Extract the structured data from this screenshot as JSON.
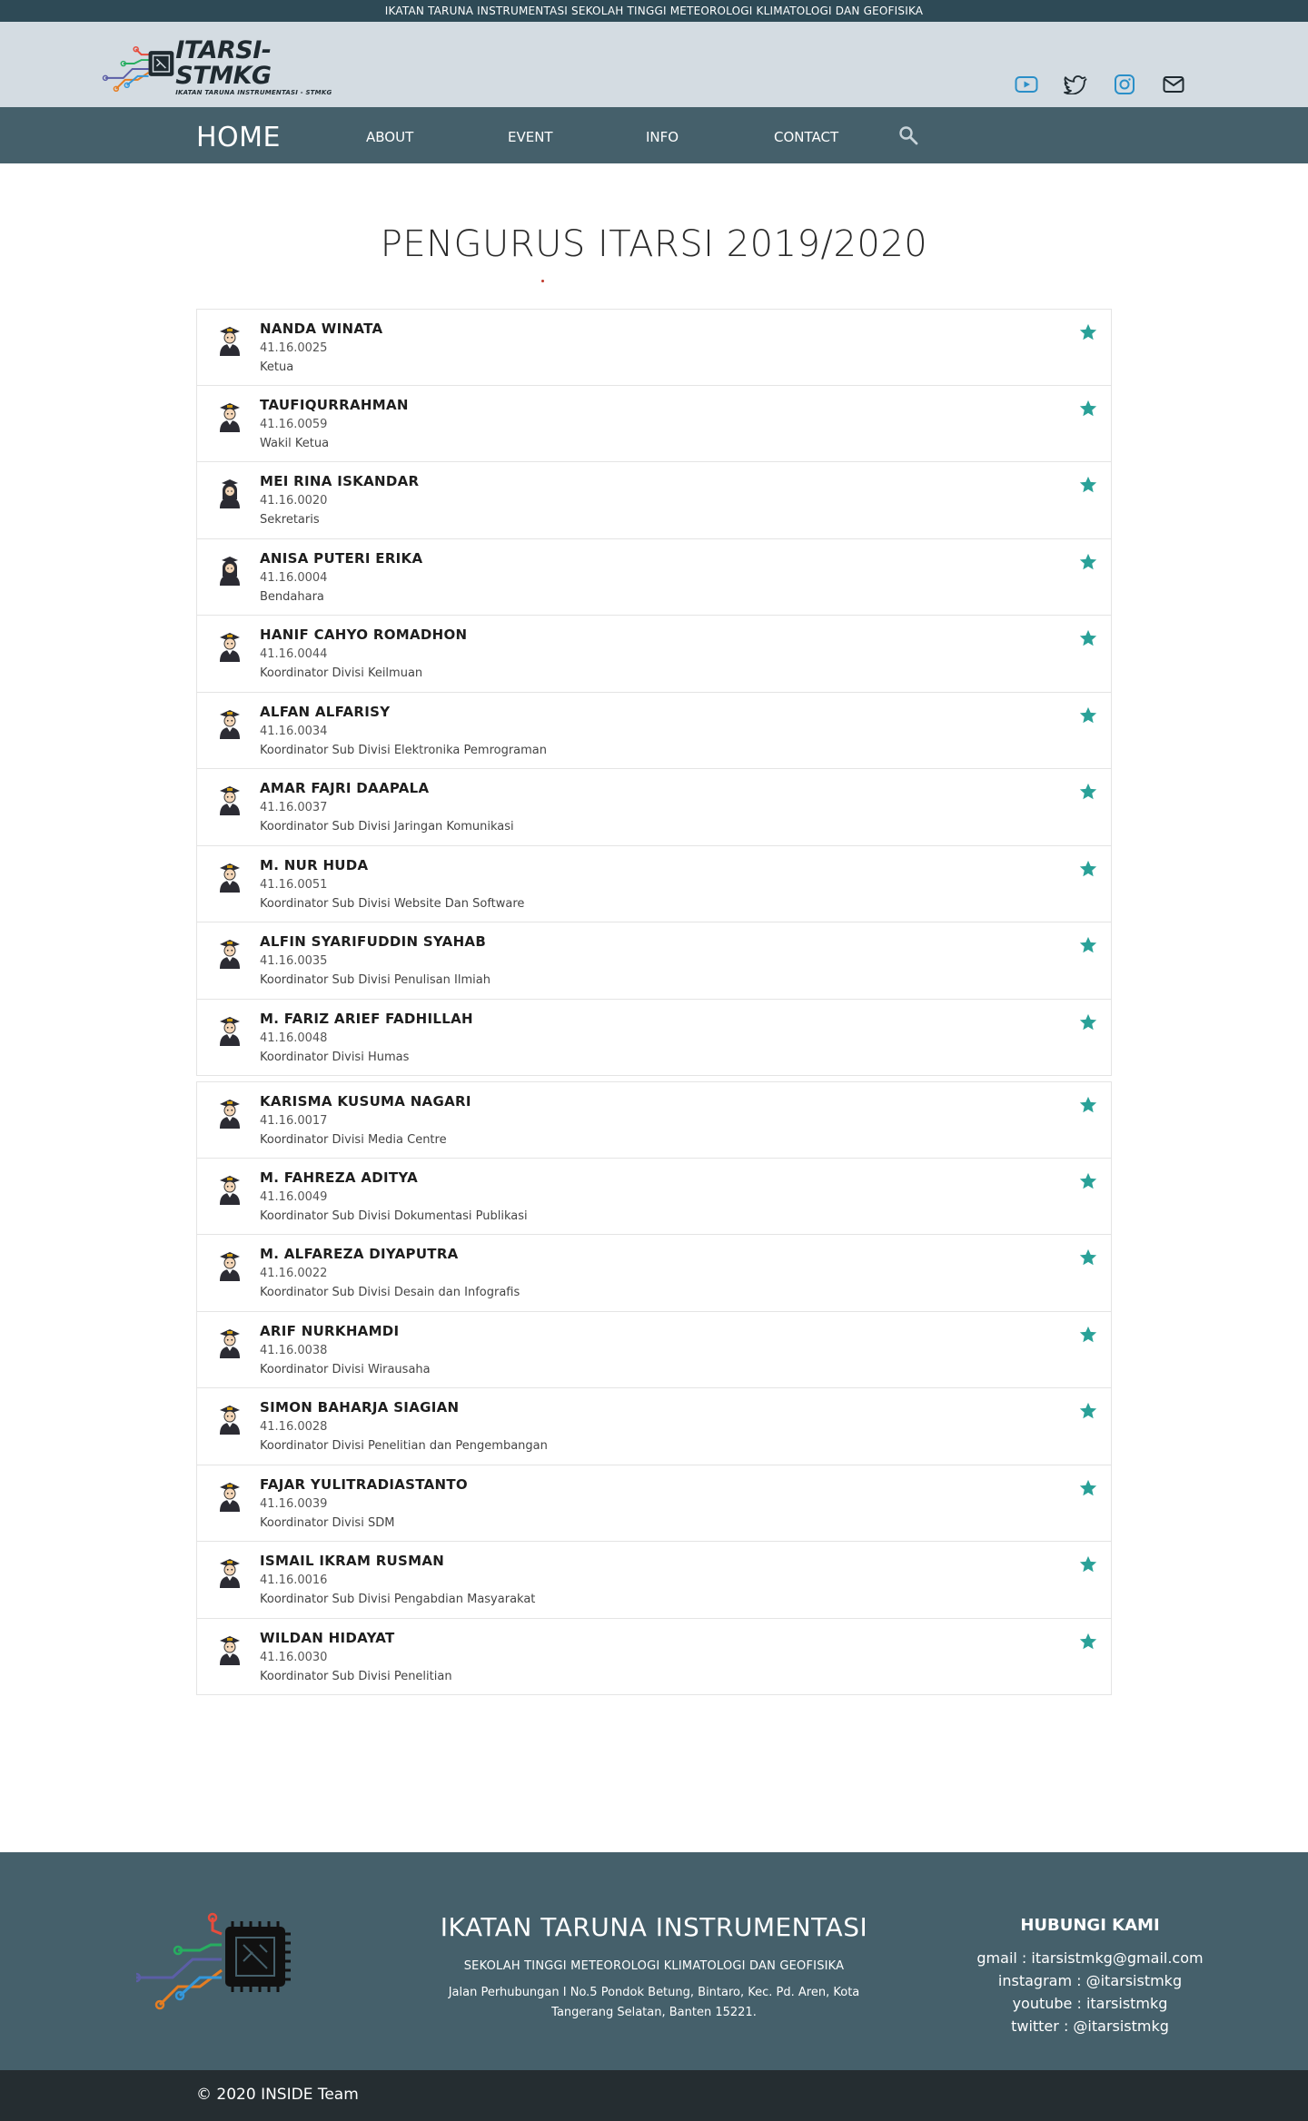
{
  "topbar": {
    "text": "IKATAN TARUNA INSTRUMENTASI SEKOLAH TINGGI METEOROLOGI KLIMATOLOGI DAN GEOFISIKA"
  },
  "brand": {
    "logo_title": "ITARSI-STMKG",
    "logo_subtitle": "IKATAN TARUNA INSTRUMENTASI - STMKG",
    "social_icons": [
      "youtube-icon",
      "twitter-icon",
      "instagram-icon",
      "mail-icon"
    ]
  },
  "nav": {
    "home": "HOME",
    "items": [
      "ABOUT",
      "EVENT",
      "INFO",
      "CONTACT"
    ],
    "search_icon": "search-icon"
  },
  "page": {
    "title": "PENGURUS ITARSI 2019/2020"
  },
  "members": [
    {
      "name": "NANDA WINATA",
      "nim": "41.16.0025",
      "role": "Ketua",
      "avatar": "male"
    },
    {
      "name": "TAUFIQURRAHMAN",
      "nim": "41.16.0059",
      "role": "Wakil Ketua",
      "avatar": "male"
    },
    {
      "name": "MEI RINA ISKANDAR",
      "nim": "41.16.0020",
      "role": "Sekretaris",
      "avatar": "female"
    },
    {
      "name": "ANISA PUTERI ERIKA",
      "nim": "41.16.0004",
      "role": "Bendahara",
      "avatar": "female"
    },
    {
      "name": "HANIF CAHYO ROMADHON",
      "nim": "41.16.0044",
      "role": "Koordinator Divisi Keilmuan",
      "avatar": "male"
    },
    {
      "name": "ALFAN ALFARISY",
      "nim": "41.16.0034",
      "role": "Koordinator Sub Divisi Elektronika Pemrograman",
      "avatar": "male"
    },
    {
      "name": "AMAR FAJRI DAAPALA",
      "nim": "41.16.0037",
      "role": "Koordinator Sub Divisi Jaringan Komunikasi",
      "avatar": "male"
    },
    {
      "name": "M. NUR HUDA",
      "nim": "41.16.0051",
      "role": "Koordinator Sub Divisi Website Dan Software",
      "avatar": "male"
    },
    {
      "name": "ALFIN SYARIFUDDIN SYAHAB",
      "nim": "41.16.0035",
      "role": "Koordinator Sub Divisi Penulisan Ilmiah",
      "avatar": "male"
    },
    {
      "name": "M. FARIZ ARIEF FADHILLAH",
      "nim": "41.16.0048",
      "role": "Koordinator Divisi Humas",
      "avatar": "male"
    },
    {
      "name": "KARISMA KUSUMA NAGARI",
      "nim": "41.16.0017",
      "role": "Koordinator Divisi Media Centre",
      "avatar": "male"
    },
    {
      "name": "M. FAHREZA ADITYA",
      "nim": "41.16.0049",
      "role": "Koordinator Sub Divisi Dokumentasi Publikasi",
      "avatar": "male"
    },
    {
      "name": "M. ALFAREZA DIYAPUTRA",
      "nim": "41.16.0022",
      "role": "Koordinator Sub Divisi Desain dan Infografis",
      "avatar": "male"
    },
    {
      "name": "ARIF NURKHAMDI",
      "nim": "41.16.0038",
      "role": "Koordinator Divisi Wirausaha",
      "avatar": "male"
    },
    {
      "name": "SIMON BAHARJA SIAGIAN",
      "nim": "41.16.0028",
      "role": "Koordinator Divisi Penelitian dan Pengembangan",
      "avatar": "male"
    },
    {
      "name": "FAJAR YULITRADIASTANTO",
      "nim": "41.16.0039",
      "role": "Koordinator Divisi SDM",
      "avatar": "male"
    },
    {
      "name": "ISMAIL IKRAM RUSMAN",
      "nim": "41.16.0016",
      "role": "Koordinator Sub Divisi Pengabdian Masyarakat",
      "avatar": "male"
    },
    {
      "name": "WILDAN HIDAYAT",
      "nim": "41.16.0030",
      "role": "Koordinator Sub Divisi Penelitian",
      "avatar": "male"
    }
  ],
  "footer": {
    "title": "IKATAN TARUNA INSTRUMENTASI",
    "subtitle": "SEKOLAH TINGGI METEOROLOGI KLIMATOLOGI DAN GEOFISIKA",
    "address": "Jalan Perhubungan I No.5 Pondok Betung, Bintaro, Kec. Pd. Aren, Kota Tangerang Selatan, Banten 15221.",
    "contact_title": "HUBUNGI KAMI",
    "contacts": [
      "gmail : itarsistmkg@gmail.com",
      "instagram : @itarsistmkg",
      "youtube : itarsistmkg",
      "twitter : @itarsistmkg"
    ],
    "copyright": "© 2020 INSIDE Team"
  },
  "colors": {
    "topbar": "#2e4a56",
    "brandbar": "#d4dce2",
    "navbar": "#45606b",
    "star": "#2aa198",
    "footer": "#45606b",
    "copyright_bar": "#252d31"
  }
}
